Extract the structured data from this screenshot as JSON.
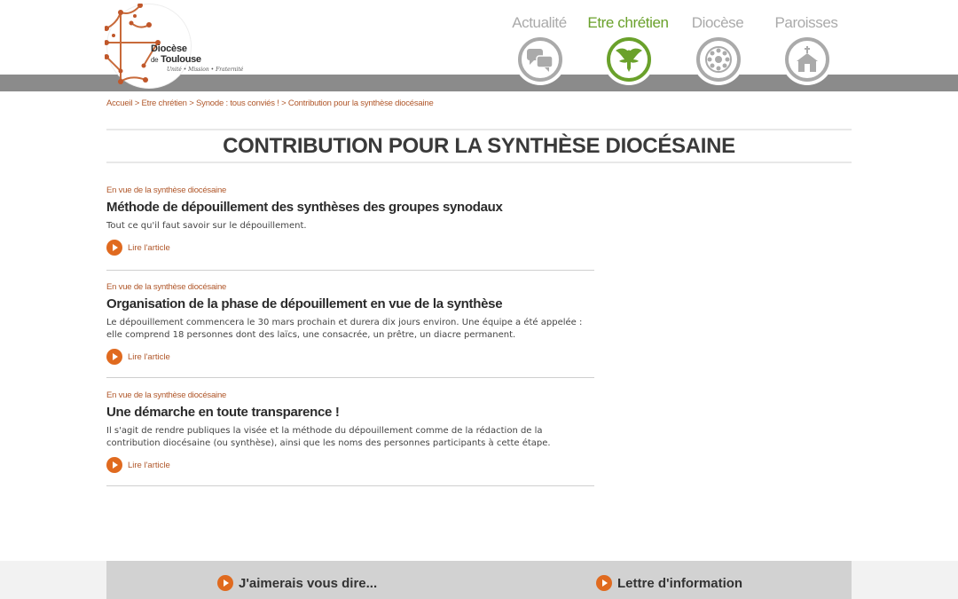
{
  "logo": {
    "line1": "Diocèse",
    "line2_small": "de",
    "line2": "Toulouse",
    "tagline": "Unité • Mission • Fraternité"
  },
  "nav": {
    "items": [
      {
        "label": "Actualité",
        "icon": "speech-bubbles-icon",
        "active": false
      },
      {
        "label": "Etre chrétien",
        "icon": "dove-icon",
        "active": true
      },
      {
        "label": "Diocèse",
        "icon": "rose-window-icon",
        "active": false
      },
      {
        "label": "Paroisses",
        "icon": "church-icon",
        "active": false
      }
    ]
  },
  "breadcrumb": {
    "items": [
      "Accueil",
      "Etre chrétien",
      "Synode : tous conviés !",
      "Contribution pour la synthèse diocésaine"
    ],
    "separator": ">"
  },
  "page_title": "CONTRIBUTION POUR LA SYNTHÈSE DIOCÉSAINE",
  "articles": [
    {
      "category": "En vue de la synthèse diocésaine",
      "title": "Méthode de dépouillement des synthèses des groupes synodaux",
      "description": "Tout ce qu'il faut savoir sur le dépouillement.",
      "link": "Lire l'article"
    },
    {
      "category": "En vue de la synthèse diocésaine",
      "title": "Organisation de la phase de dépouillement en vue de la synthèse",
      "description": "Le dépouillement commencera le 30 mars prochain et durera dix jours environ. Une équipe a été appelée : elle comprend 18 personnes dont des laïcs, une consacrée, un prêtre, un diacre permanent.",
      "link": "Lire l'article"
    },
    {
      "category": "En vue de la synthèse diocésaine",
      "title": "Une démarche en toute transparence !",
      "description": "Il s'agit de rendre publiques la visée et la méthode du dépouillement comme de la rédaction de la contribution diocésaine (ou synthèse), ainsi que les noms des personnes participants à cette étape.",
      "link": "Lire l'article"
    }
  ],
  "footer": {
    "left": "J'aimerais vous dire...",
    "right": "Lettre d'information"
  },
  "colors": {
    "accent": "#b0572a",
    "play": "#e06a1f",
    "active_nav": "#6aa12b",
    "nav_inactive": "#aaaaaa",
    "band": "#8b8b8b"
  }
}
